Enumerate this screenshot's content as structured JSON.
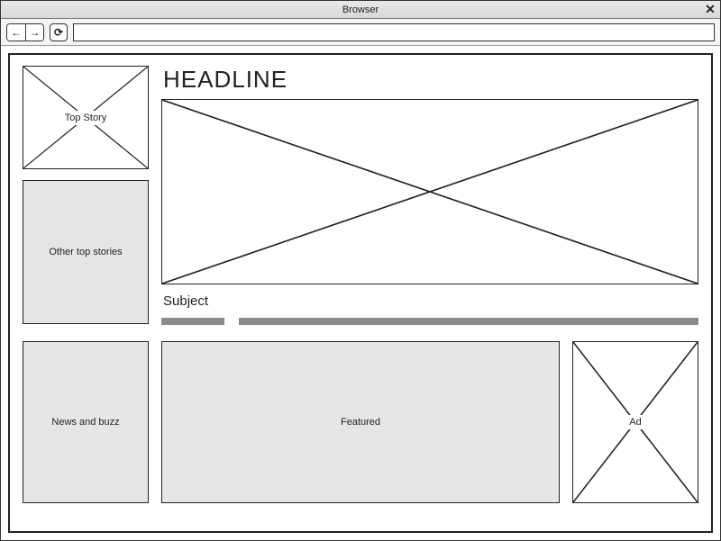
{
  "window": {
    "title": "Browser",
    "close_icon": "✕"
  },
  "toolbar": {
    "back_icon": "←",
    "forward_icon": "→",
    "reload_icon": "⟳",
    "url_value": ""
  },
  "sidebar": {
    "top_story_label": "Top Story",
    "other_top_label": "Other top stories"
  },
  "main": {
    "headline": "HEADLINE",
    "subject": "Subject"
  },
  "bottom": {
    "news_buzz_label": "News and buzz",
    "featured_label": "Featured",
    "ad_label": "Ad"
  }
}
